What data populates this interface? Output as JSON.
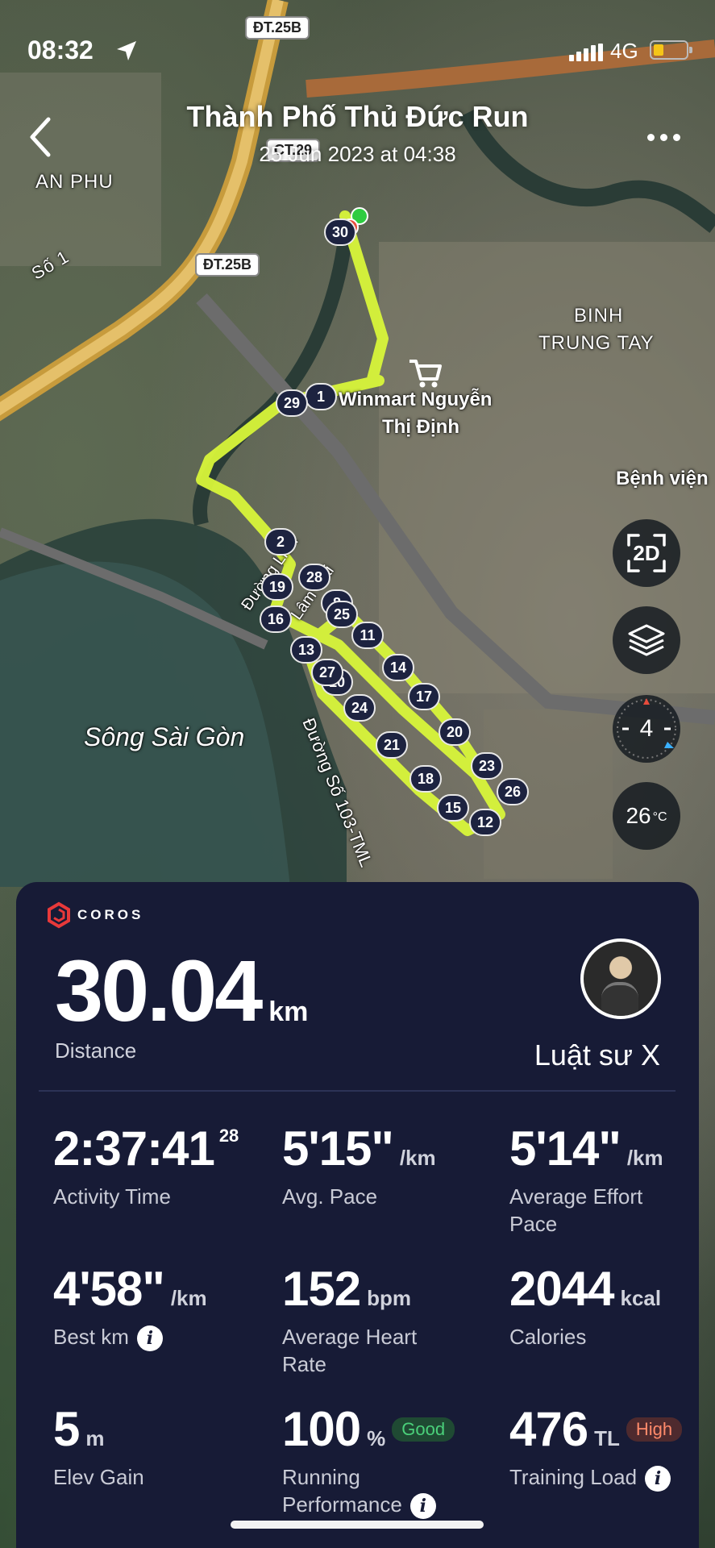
{
  "status_bar": {
    "time": "08:32",
    "network": "4G",
    "signal_icon": "signal-bars-icon",
    "location_icon": "location-arrow-icon"
  },
  "header": {
    "title": "Thành Phố Thủ Đức Run",
    "subtitle": "25 Jun 2023 at 04:38",
    "back_icon": "chevron-left-icon",
    "more_icon": "ellipsis-icon"
  },
  "map": {
    "labels": {
      "an_phu": "AN PHU",
      "so_1": "Số 1",
      "binh_trung_tay_1": "BINH",
      "binh_trung_tay_2": "TRUNG TAY",
      "winmart_1": "Winmart Nguyễn",
      "winmart_2": "Thị Định",
      "benh_vien": "Bệnh viện",
      "song_sai_gon": "Sông Sài Gòn",
      "duong_so_103": "Đường Số 103-TML",
      "duong_lien": "Đường Liên",
      "lam_mai": "Lâm Mai"
    },
    "road_tags": {
      "dt25b_top": "ĐT.25B",
      "dt25b_mid": "ĐT.25B",
      "ct29": "CT.29"
    },
    "laps": [
      "1",
      "2",
      "8",
      "10",
      "11",
      "12",
      "13",
      "14",
      "15",
      "16",
      "17",
      "18",
      "19",
      "20",
      "21",
      "23",
      "24",
      "25",
      "26",
      "27",
      "28",
      "29",
      "30"
    ],
    "route_color": "#d8f53a"
  },
  "controls": {
    "view_2d": "2D",
    "layers_icon": "layers-icon",
    "compass_value": "4",
    "temperature": "26",
    "temperature_unit": "°C"
  },
  "card": {
    "brand": "COROS",
    "distance": {
      "value": "30.04",
      "unit": "km",
      "label": "Distance"
    },
    "user_name": "Luật sư X",
    "stats": {
      "activity_time": {
        "value": "2:37:41",
        "sup": "28",
        "label": "Activity Time"
      },
      "avg_pace": {
        "value": "5'15\"",
        "unit": "/km",
        "label": "Avg. Pace"
      },
      "effort_pace": {
        "value": "5'14\"",
        "unit": "/km",
        "label": "Average Effort Pace"
      },
      "best_km": {
        "value": "4'58\"",
        "unit": "/km",
        "label": "Best km"
      },
      "avg_hr": {
        "value": "152",
        "unit": "bpm",
        "label": "Average Heart Rate"
      },
      "calories": {
        "value": "2044",
        "unit": "kcal",
        "label": "Calories"
      },
      "elev_gain": {
        "value": "5",
        "unit": "m",
        "label": "Elev Gain"
      },
      "running_perf": {
        "value": "100",
        "unit": "%",
        "badge": "Good",
        "label": "Running Performance"
      },
      "training_load": {
        "value": "476",
        "unit": "TL",
        "badge": "High",
        "label": "Training Load"
      }
    },
    "colors": {
      "card_bg": "#171b36",
      "good": "#4ad07a",
      "high": "#ff8a6a",
      "brand_red": "#e8393a"
    }
  }
}
